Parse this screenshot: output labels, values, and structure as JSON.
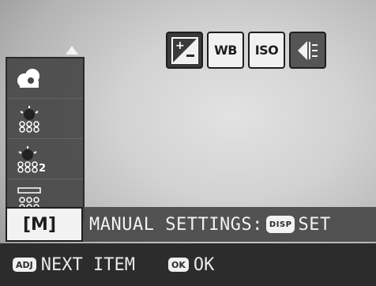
{
  "toolbar": {
    "buttons": [
      {
        "id": "exposure",
        "icon": "exposure-compensation-icon",
        "label": "",
        "state": "selected"
      },
      {
        "id": "wb",
        "icon": "",
        "label": "WB",
        "state": "normal"
      },
      {
        "id": "iso",
        "icon": "",
        "label": "ISO",
        "state": "normal"
      },
      {
        "id": "focus",
        "icon": "focus-bracket-icon",
        "label": "",
        "state": "dark"
      }
    ]
  },
  "wb_menu": {
    "items": [
      {
        "icon": "cloudy-icon"
      },
      {
        "icon": "incandescent-icon"
      },
      {
        "icon": "incandescent-2-icon",
        "suffix": "2"
      },
      {
        "icon": "fluorescent-icon"
      }
    ],
    "selected_label": "[M]"
  },
  "caption": {
    "text": "MANUAL SETTINGS:",
    "key_badge": "DISP",
    "action": "SET"
  },
  "bottom": {
    "adj_badge": "ADJ",
    "adj_text": "NEXT ITEM",
    "ok_badge": "OK",
    "ok_text": "OK"
  },
  "colors": {
    "panel": "#464646",
    "bar": "#2c2c2c",
    "highlight": "#f2f2f2"
  }
}
